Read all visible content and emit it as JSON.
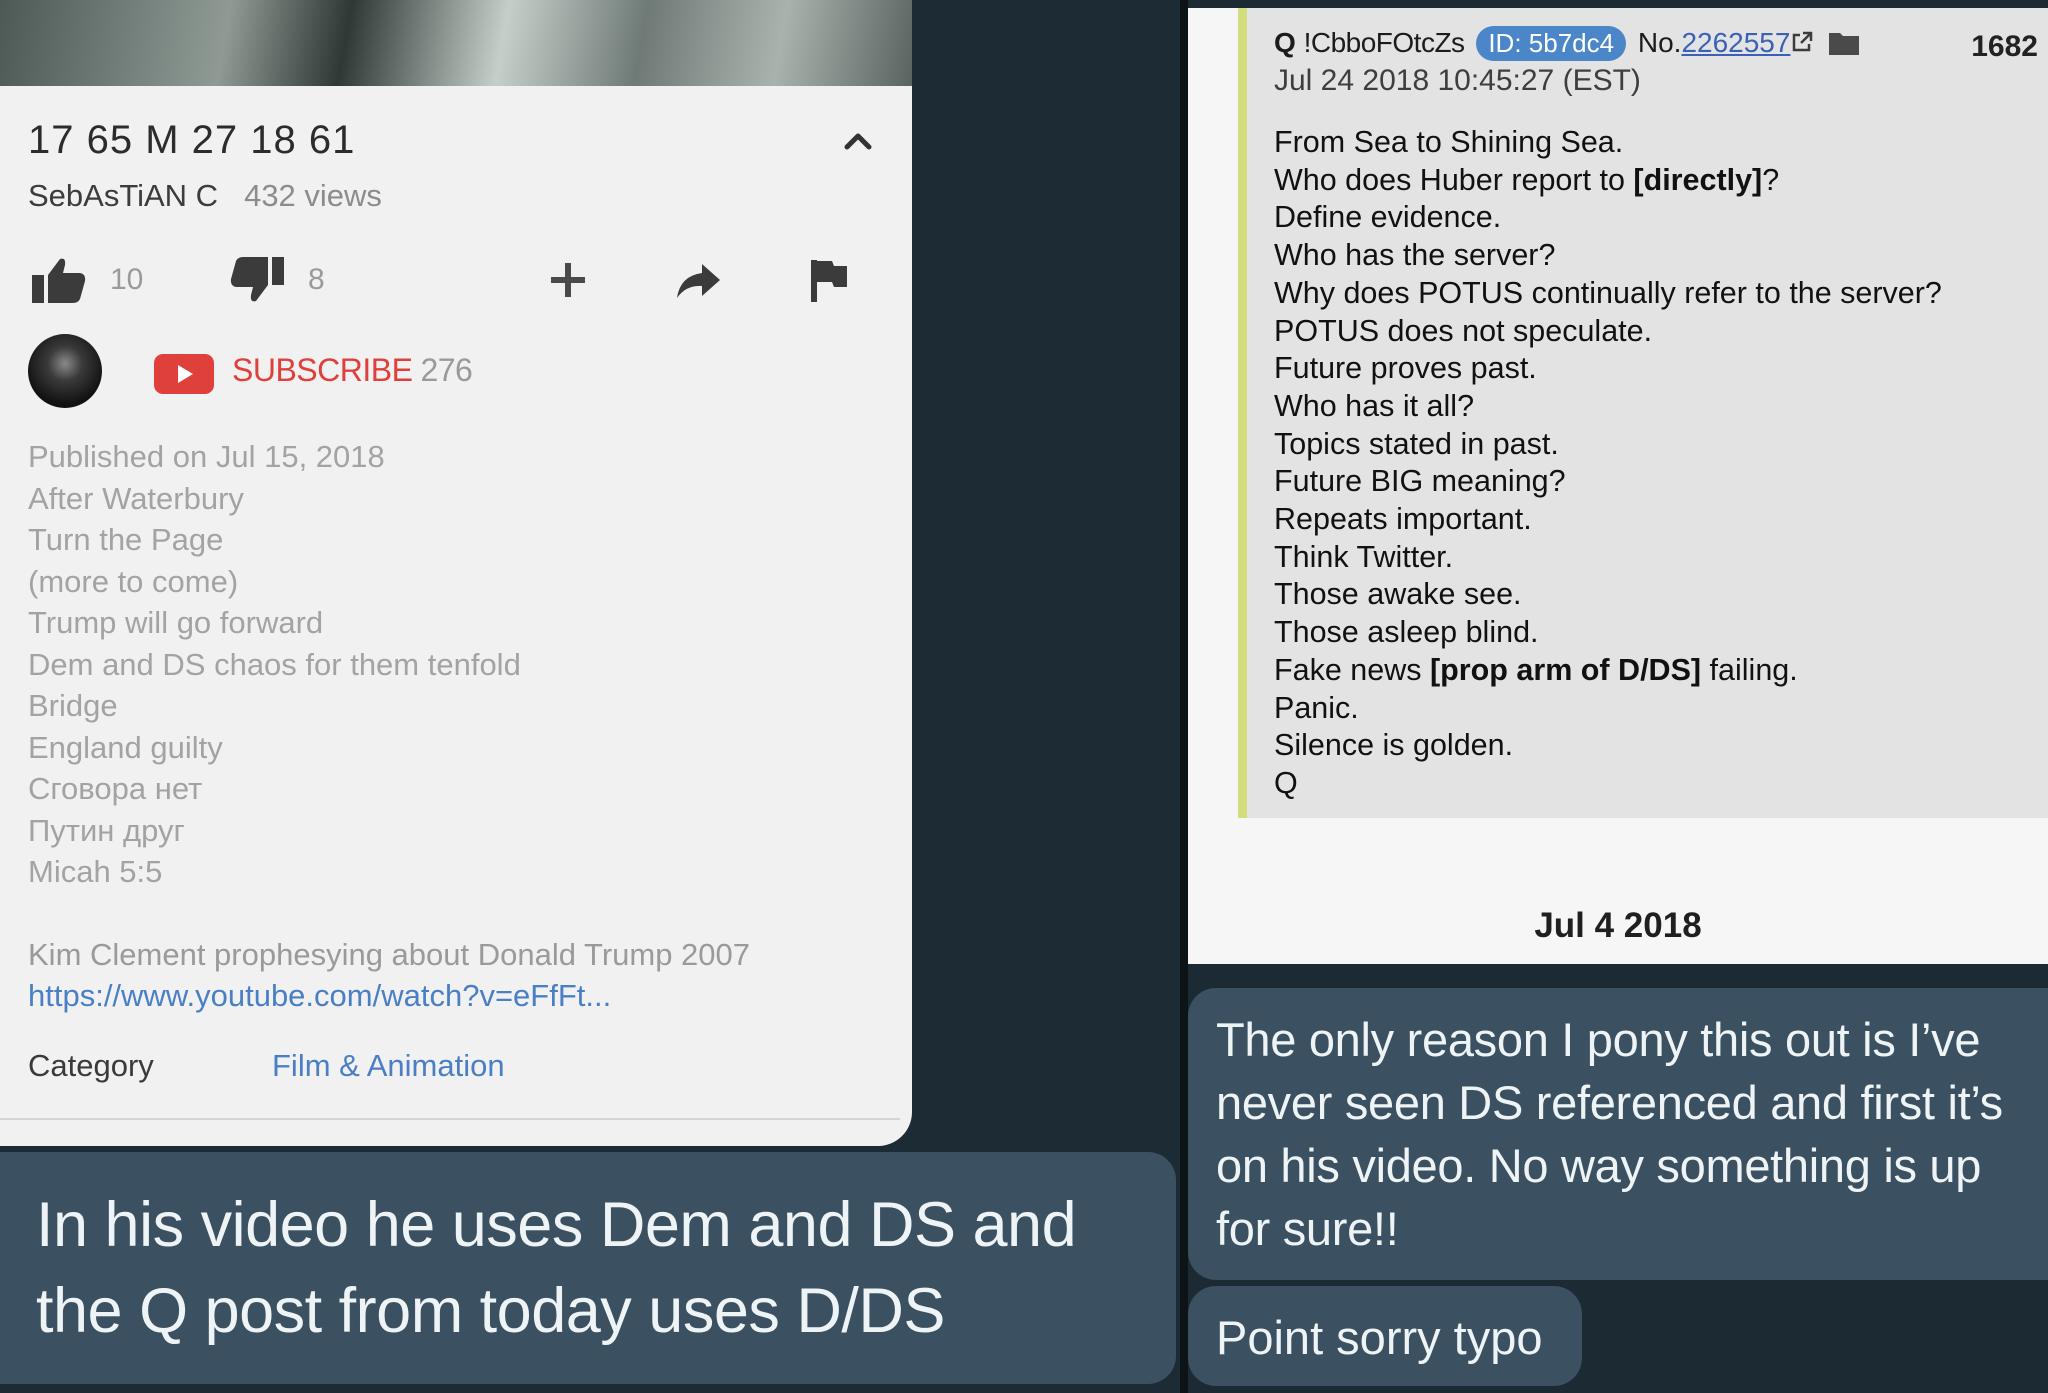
{
  "youtube": {
    "title": "17 65 M 27 18 61",
    "channel": "SebAsTiAN C",
    "views": "432 views",
    "likes": "10",
    "dislikes": "8",
    "subscribe_label": "SUBSCRIBE",
    "subscriber_count": "276",
    "description_lines": [
      "Published on Jul 15, 2018",
      "After Waterbury",
      "Turn the Page",
      "(more to come)",
      "Trump will go forward",
      "Dem and DS chaos for them tenfold",
      "Bridge",
      "England guilty",
      "Сговора нет",
      "Путин друг",
      "Micah 5:5"
    ],
    "extra_text": "Kim Clement prophesying about Donald Trump 2007",
    "link": "https://www.youtube.com/watch?v=eFfFt...",
    "category_label": "Category",
    "category_value": "Film & Animation",
    "accent_red": "#e0403c",
    "link_blue": "#4a7fc6"
  },
  "left_message": "In his video he uses Dem and DS and the Q post from today uses D/DS",
  "q_post": {
    "author": "Q",
    "tripcode": "!CbboFOtcZs",
    "id_badge": "ID: 5b7dc4",
    "no_label": "No.",
    "post_number": "2262557",
    "count": "1682",
    "date": "Jul 24 2018 10:45:27 (EST)",
    "lines": [
      "From Sea to Shining Sea.",
      "Who does Huber report to ",
      "Define evidence.",
      "Who has the server?",
      "Why does POTUS continually refer to the server?",
      "POTUS does not speculate.",
      "Future proves past.",
      "Who has it all?",
      "Topics stated in past.",
      "Future BIG meaning?",
      "Repeats important.",
      "Think Twitter.",
      "Those awake see.",
      "Those asleep blind.",
      "Fake news ",
      "Panic.",
      "Silence is golden.",
      "Q"
    ],
    "line2_bold": "[directly]",
    "line2_after": "?",
    "line15_bold": "[prop arm of D/DS]",
    "line15_after": " failing.",
    "border_color": "#d3dd7e",
    "badge_color": "#4b86c8"
  },
  "date_separator": "Jul 4 2018",
  "right_messages": [
    "The only reason I pony this out is I’ve never seen DS referenced and first it’s on his video. No way something is up for sure!!",
    "Point sorry typo"
  ],
  "icons": {
    "collapse": "chevron-up-icon",
    "like": "thumbs-up-icon",
    "dislike": "thumbs-down-icon",
    "add": "plus-icon",
    "share": "share-arrow-icon",
    "report": "flag-icon",
    "youtube": "youtube-logo-icon",
    "external": "external-link-icon",
    "folder": "folder-icon"
  },
  "bubble_color": "#3b5060"
}
